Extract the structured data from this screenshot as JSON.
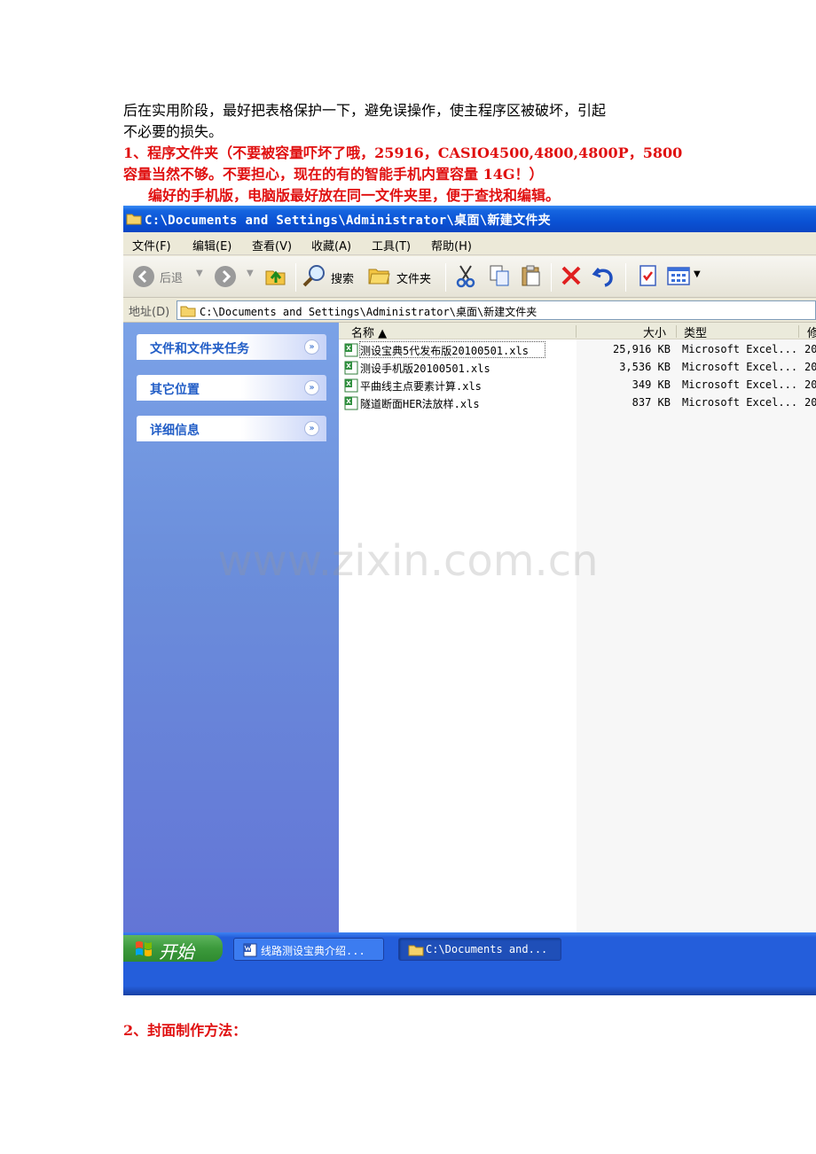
{
  "document": {
    "intro_line1": "后在实用阶段，最好把表格保护一下，避免误操作，使主程序区被破坏，引起",
    "intro_line2": "不必要的损失。",
    "section1_line1": "1、程序文件夹（不要被容量吓坏了哦，25916，CASIO4500,4800,4800P，5800",
    "section1_line2": "容量当然不够。不要担心，现在的有的智能手机内置容量 14G！）",
    "section1_note": "编好的手机版，电脑版最好放在同一文件夹里，便于查找和编辑。",
    "section2_title": "2、封面制作方法：",
    "watermark": "www.zixin.com.cn"
  },
  "window": {
    "title": "C:\\Documents and Settings\\Administrator\\桌面\\新建文件夹",
    "menu": [
      "文件(F)",
      "编辑(E)",
      "查看(V)",
      "收藏(A)",
      "工具(T)",
      "帮助(H)"
    ],
    "toolbar": {
      "back_label": "后退",
      "search_label": "搜索",
      "folders_label": "文件夹"
    },
    "address": {
      "label": "地址(D)",
      "value": "C:\\Documents and Settings\\Administrator\\桌面\\新建文件夹"
    },
    "tasks": [
      "文件和文件夹任务",
      "其它位置",
      "详细信息"
    ],
    "columns": {
      "name": "名称 ▲",
      "size": "大小",
      "type": "类型",
      "modified": "修"
    },
    "files": [
      {
        "name": "测设宝典5代发布版20100501.xls",
        "size": "25,916 KB",
        "type": "Microsoft Excel...",
        "date": "20"
      },
      {
        "name": "测设手机版20100501.xls",
        "size": "3,536 KB",
        "type": "Microsoft Excel...",
        "date": "20"
      },
      {
        "name": "平曲线主点要素计算.xls",
        "size": "349 KB",
        "type": "Microsoft Excel...",
        "date": "20"
      },
      {
        "name": "隧道断面HER法放样.xls",
        "size": "837 KB",
        "type": "Microsoft Excel...",
        "date": "20"
      }
    ]
  },
  "taskbar": {
    "start_label": "开始",
    "buttons": [
      "线路测设宝典介绍...",
      "C:\\Documents and..."
    ]
  }
}
